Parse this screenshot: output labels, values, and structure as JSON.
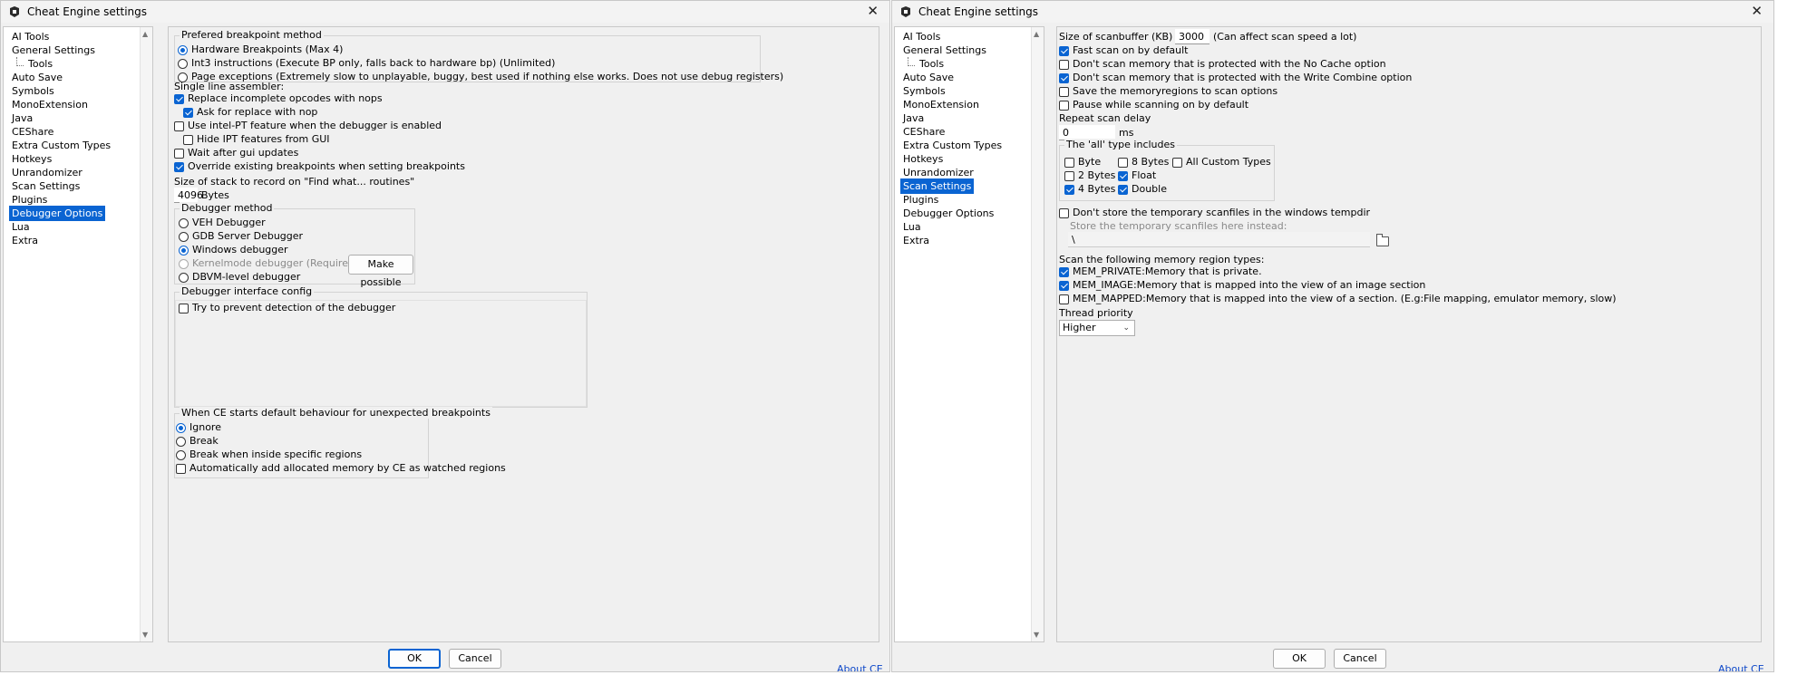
{
  "left_window": {
    "title": "Cheat Engine settings",
    "close_glyph": "✕",
    "sidebar": {
      "items": [
        "AI Tools",
        "General Settings",
        "Tools",
        "Auto Save",
        "Symbols",
        "MonoExtension",
        "Java",
        "CEShare",
        "Extra Custom Types",
        "Hotkeys",
        "Unrandomizer",
        "Scan Settings",
        "Plugins",
        "Debugger Options",
        "Lua",
        "Extra"
      ],
      "selected": "Debugger Options"
    },
    "breakpoint_method": {
      "title": "Prefered breakpoint method",
      "options": [
        "Hardware Breakpoints (Max 4)",
        "Int3 instructions (Execute BP only, falls back to hardware bp) (Unlimited)",
        "Page exceptions (Extremely slow to unplayable, buggy, best used if nothing else works. Does not use debug registers)"
      ],
      "selected_index": 0
    },
    "single_line_assembler": "Single line assembler:",
    "checks": {
      "replace_incomplete": "Replace incomplete opcodes with nops",
      "ask_replace": "Ask for replace with nop",
      "intel_pt": "Use intel-PT feature when the debugger is enabled",
      "hide_ipt": "Hide IPT features from GUI",
      "wait_gui": "Wait after gui updates",
      "override_bp": "Override existing breakpoints when setting breakpoints"
    },
    "stack_label": "Size of stack to record on \"Find what... routines\"",
    "stack_value": "4096",
    "stack_unit": "Bytes",
    "debugger_method": {
      "title": "Debugger method",
      "options": [
        "VEH Debugger",
        "GDB Server Debugger",
        "Windows debugger",
        "Kernelmode debugger (Requires DBVM)",
        "DBVM-level debugger"
      ],
      "selected_index": 2,
      "make_possible": "Make possible"
    },
    "interface_config": {
      "title": "Debugger interface config",
      "prevent_detection": "Try to prevent detection of the debugger"
    },
    "unexpected_bp": {
      "title": "When CE starts default behaviour for unexpected breakpoints",
      "options": [
        "Ignore",
        "Break",
        "Break when inside specific regions"
      ],
      "selected_index": 0,
      "auto_add": "Automatically add allocated memory by CE as watched regions"
    },
    "ok": "OK",
    "cancel": "Cancel",
    "about": "About CE"
  },
  "right_window": {
    "title": "Cheat Engine settings",
    "close_glyph": "✕",
    "sidebar": {
      "items": [
        "AI Tools",
        "General Settings",
        "Tools",
        "Auto Save",
        "Symbols",
        "MonoExtension",
        "Java",
        "CEShare",
        "Extra Custom Types",
        "Hotkeys",
        "Unrandomizer",
        "Scan Settings",
        "Plugins",
        "Debugger Options",
        "Lua",
        "Extra"
      ],
      "selected": "Scan Settings"
    },
    "scanbuffer_label": "Size of scanbuffer (KB) :",
    "scanbuffer_value": "3000",
    "scanbuffer_note": "(Can affect scan speed a lot)",
    "checks": {
      "fast_scan": "Fast scan on by default",
      "no_cache": "Don't scan memory that is protected with the No Cache option",
      "write_combine": "Don't scan memory that is protected with the Write Combine option",
      "save_regions": "Save the memoryregions to scan options",
      "pause_scan": "Pause while scanning on by default"
    },
    "repeat_delay_label": "Repeat scan delay",
    "repeat_delay_value": "0",
    "repeat_delay_unit": "ms",
    "all_type": {
      "title": "The 'all' type includes",
      "byte": "Byte",
      "bytes8": "8 Bytes",
      "custom": "All Custom Types",
      "bytes2": "2 Bytes",
      "float": "Float",
      "bytes4": "4 Bytes",
      "double": "Double"
    },
    "no_temp": "Don't store the temporary scanfiles in the windows tempdir",
    "store_label": "Store the temporary scanfiles here instead:",
    "store_value": "\\",
    "mem_region_label": "Scan the following memory region types:",
    "mem_private": "MEM_PRIVATE:Memory that is private.",
    "mem_image": "MEM_IMAGE:Memory that is mapped into the view of an image section",
    "mem_mapped": "MEM_MAPPED:Memory that is mapped into the view of a section. (E.g:File mapping, emulator memory, slow)",
    "thread_priority_label": "Thread priority",
    "thread_priority_value": "Higher",
    "ok": "OK",
    "cancel": "Cancel",
    "about": "About CE"
  },
  "colors": {
    "accent": "#0a64d2",
    "link": "#0a45c8"
  }
}
